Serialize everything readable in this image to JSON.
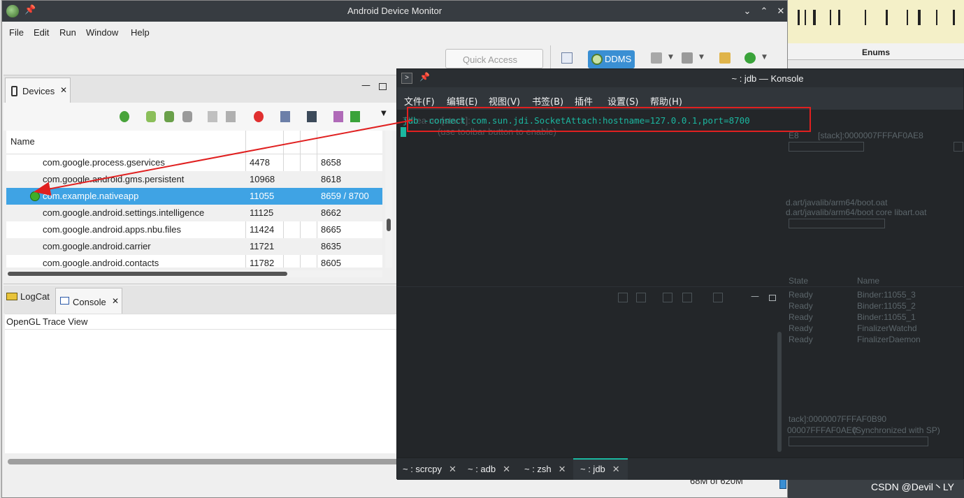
{
  "adm": {
    "title": "Android Device Monitor",
    "controls": {
      "minimize": "⌄",
      "maximize": "⌃",
      "close": "✕"
    },
    "menu": [
      "File",
      "Edit",
      "Run",
      "Window",
      "Help"
    ],
    "quick_access_placeholder": "Quick Access",
    "perspective_label": "DDMS",
    "devices": {
      "tab_label": "Devices",
      "column_name": "Name",
      "rows": [
        {
          "name": "com.google.process.gservices",
          "pid": "4478",
          "port": "8658"
        },
        {
          "name": "com.google.android.gms.persistent",
          "pid": "10968",
          "port": "8618"
        },
        {
          "name": "com.example.nativeapp",
          "pid": "11055",
          "port": "8659 / 8700",
          "selected": true
        },
        {
          "name": "com.google.android.settings.intelligence",
          "pid": "11125",
          "port": "8662"
        },
        {
          "name": "com.google.android.apps.nbu.files",
          "pid": "11424",
          "port": "8665"
        },
        {
          "name": "com.google.android.carrier",
          "pid": "11721",
          "port": "8635"
        },
        {
          "name": "com.google.android.contacts",
          "pid": "11782",
          "port": "8605"
        }
      ]
    },
    "bottom_tabs": {
      "logcat": "LogCat",
      "console": "Console"
    },
    "console_title": "OpenGL Trace View",
    "heap_status": "68M of 620M"
  },
  "background": {
    "enums_header": "Enums",
    "stack_text": "[stack]:0000007FFFAF0AE8",
    "stack_prefix": "E8",
    "boot_oat": "d.art/javalib/arm64/boot.oat",
    "boot_core": "d.art/javalib/arm64/boot core libart.oat",
    "thread_cols": {
      "state": "State",
      "name": "Name"
    },
    "threads": [
      {
        "state": "Ready",
        "name": "Binder:11055_3"
      },
      {
        "state": "Ready",
        "name": "Binder:11055_2"
      },
      {
        "state": "Ready",
        "name": "Binder:11055_1"
      },
      {
        "state": "Ready",
        "name": "FinalizerWatchd"
      },
      {
        "state": "Ready",
        "name": "FinalizerDaemon"
      }
    ],
    "stack2": "tack]:0000007FFFAF0B90",
    "stack3": "00007FFFAF0AE0",
    "synchronized": "(Synchronized with SP)",
    "watermark": "CSDN @Devil丶LY"
  },
  "konsole": {
    "title": "~ : jdb — Konsole",
    "menu": [
      "文件(F)",
      "编辑(E)",
      "视图(V)",
      "书签(B)",
      "插件",
      "设置(S)",
      "帮助(H)"
    ],
    "command": "jdb -connect com.sun.jdi.SocketAttach:hostname=127.0.0.1,port=8700",
    "ghost_line1": "Threa            no        [stack]:",
    "ghost_line2": "(use toolbar button to enable)",
    "tabs": [
      {
        "label": "~ : scrcpy",
        "active": false
      },
      {
        "label": "~ : adb",
        "active": false
      },
      {
        "label": "~ : zsh",
        "active": false
      },
      {
        "label": "~ : jdb",
        "active": true
      }
    ]
  },
  "colors": {
    "highlight_box": "#e02020",
    "arrow": "#e02020",
    "selection": "#3fa3e4",
    "terminal_text": "#1bb7a0"
  }
}
